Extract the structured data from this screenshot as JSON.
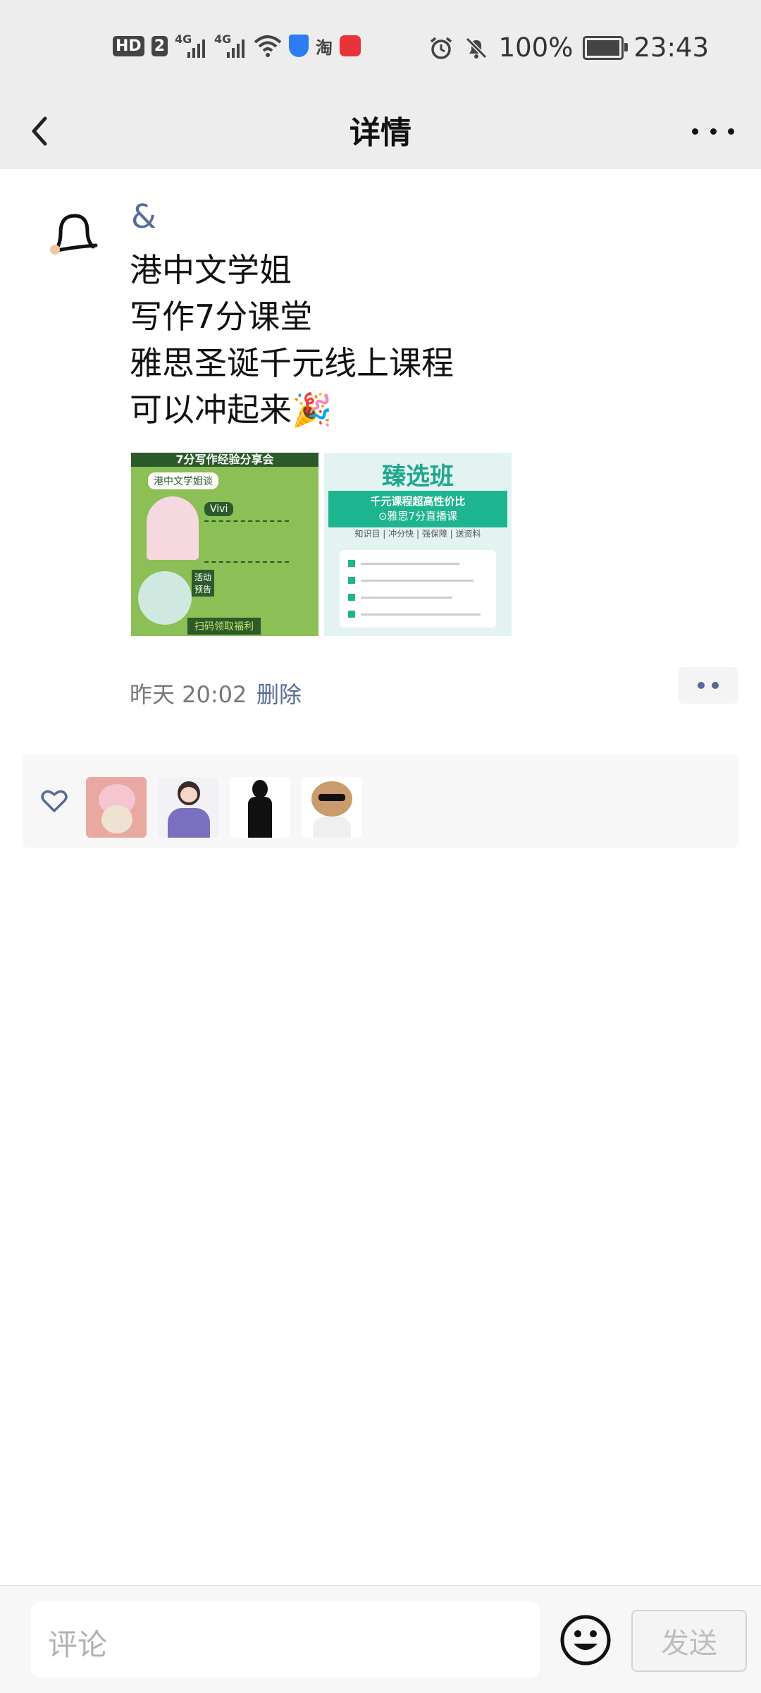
{
  "status_bar": {
    "hd_label": "HD",
    "sim_label": "2",
    "sim1_tag": "4G",
    "sim2_tag": "4G",
    "taobao_label": "淘",
    "battery_percent": "100%",
    "time": "23:43",
    "battery_level": 1.0
  },
  "nav": {
    "title": "详情"
  },
  "post": {
    "name": "&",
    "lines": [
      "港中文学姐",
      "写作7分课堂",
      "雅思圣诞千元线上课程",
      "可以冲起来🎉"
    ],
    "images": [
      {
        "header": "7分写作经验分享会",
        "sub": "港中文学姐谈",
        "badge": "Vivi",
        "badge2": "活动\n预告",
        "footer": "扫码领取福利"
      },
      {
        "header": "臻选班",
        "banner": "千元课程超高性价比",
        "banner2": "⊙雅思7分直播课",
        "tags": [
          "知识目 | 冲分快 | 强保障 | 送资料"
        ]
      }
    ],
    "time": "昨天 20:02",
    "delete_label": "删除",
    "accent_color": "#576b95"
  },
  "likes": {
    "icon": "heart-outline-icon",
    "avatars": [
      "avatar-bear-pink",
      "avatar-girl",
      "avatar-silhouette",
      "avatar-bear-sunglasses"
    ]
  },
  "bottom_bar": {
    "comment_placeholder": "评论",
    "emoji_icon": "smiley-face-icon",
    "send_label": "发送"
  }
}
